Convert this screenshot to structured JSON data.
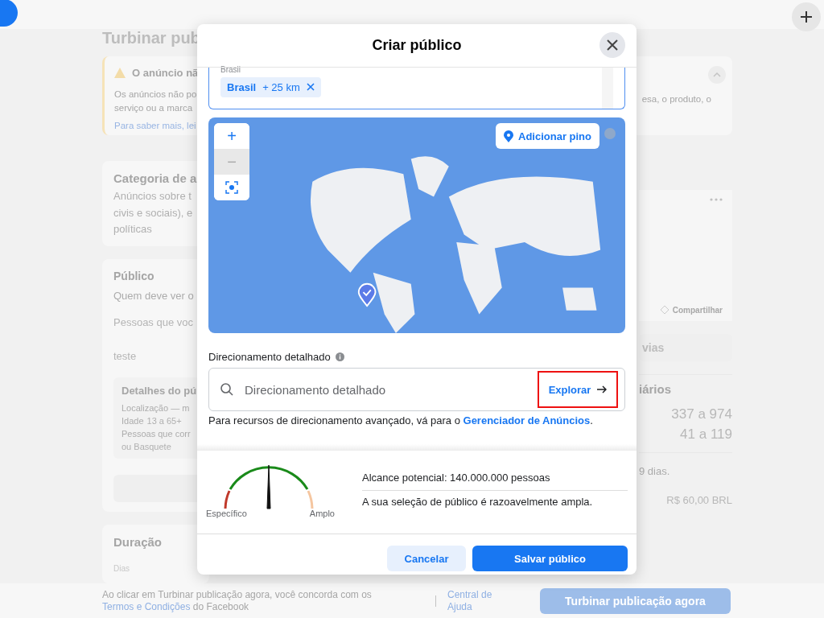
{
  "page": {
    "title": "Turbinar pub",
    "warning": {
      "title": "O anúncio nã",
      "lines": [
        "Os anúncios não po",
        "serviço ou a marca"
      ],
      "link": "Para saber mais, lei",
      "right_text": "esa, o produto, o"
    },
    "category": {
      "title": "Categoria de a",
      "lines": [
        "Anúncios sobre t",
        "civis e sociais), e",
        "políticas"
      ]
    },
    "audience": {
      "title": "Público",
      "subtitle": "Quem deve ver o",
      "prompt": "Pessoas que voc",
      "saved": "teste",
      "details": {
        "title": "Detalhes do pú",
        "location": "Localização — m",
        "age_label": "Idade",
        "age_value": "13 a 65+",
        "interests_label": "Pessoas que corr",
        "interests_value": "ou Basquete"
      }
    },
    "duration": {
      "title": "Duração",
      "field_label": "Dias"
    },
    "preview": {
      "share": "Compartilhar",
      "button": "vias"
    },
    "results": {
      "title": "iários",
      "values": [
        "337 a 974",
        "41 a 119"
      ],
      "note": "9 dias.",
      "total": "R$ 60,00 BRL"
    }
  },
  "modal": {
    "title": "Criar público",
    "location": {
      "label": "Brasil",
      "tag": {
        "name": "Brasil",
        "radius": "+ 25 km"
      }
    },
    "map": {
      "add_pin": "Adicionar pino",
      "zoom_in": "+",
      "zoom_out": "−",
      "zoom_out_disabled": true
    },
    "detailed": {
      "label": "Direcionamento detalhado",
      "placeholder": "Direcionamento detalhado",
      "explore": "Explorar",
      "explore_highlighted": true,
      "help": "Para recursos de direcionamento avançado, vá para o ",
      "help_link": "Gerenciador de Anúncios",
      "help_end": "."
    },
    "gauge": {
      "min_label": "Específico",
      "max_label": "Amplo"
    },
    "reach": "Alcance potencial: 140.000.000 pessoas",
    "reach_note": "A sua seleção de público é razoavelmente ampla.",
    "buttons": {
      "cancel": "Cancelar",
      "save": "Salvar público"
    }
  },
  "footer": {
    "text": "Ao clicar em Turbinar publicação agora, você concorda com os ",
    "terms": "Termos e Condições",
    "text_end": " do Facebook",
    "help": "Central de Ajuda",
    "boost": "Turbinar publicação agora",
    "boost_disabled": true
  }
}
